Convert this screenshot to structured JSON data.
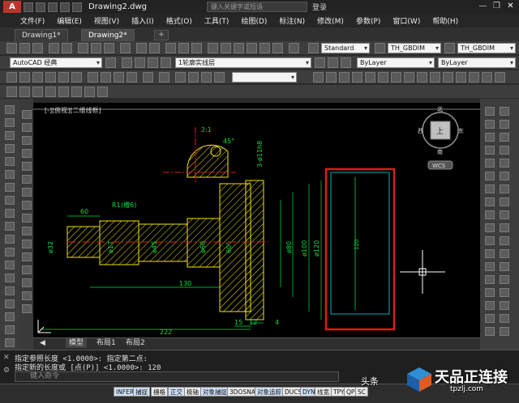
{
  "titlebar": {
    "logo": "A",
    "document_title": "Drawing2.dwg",
    "search_placeholder": "键入关键字或短语",
    "login": "登录",
    "minimize": "—",
    "restore": "❐",
    "close": "✕"
  },
  "menu": [
    "文件(F)",
    "编辑(E)",
    "视图(V)",
    "插入(I)",
    "格式(O)",
    "工具(T)",
    "绘图(D)",
    "标注(N)",
    "修改(M)",
    "参数(P)",
    "窗口(W)",
    "帮助(H)"
  ],
  "tabs": [
    {
      "label": "Drawing1*"
    },
    {
      "label": "Drawing2*"
    }
  ],
  "toolbar": {
    "dimstyle": "TH_GBDIM",
    "dimstyle2": "TH_GBDIM",
    "workspace": "AutoCAD 经典",
    "layer": "1轮廓实线层",
    "color": "ByLayer",
    "linetype": "ByLayer"
  },
  "canvas": {
    "viewport_label": "[-][俯视][二维线框]",
    "viewcube": {
      "north": "北",
      "south": "南",
      "west": "西",
      "east": "东",
      "top": "上",
      "wcs": "WCS"
    },
    "dims": {
      "d1": "2:1",
      "d2": "45°",
      "d3": "3-ø11h8",
      "d4": "R1",
      "d5": "(槽6)",
      "d6": "60",
      "d7": "ø32",
      "d8": "ø17",
      "d9": "ø45",
      "d10": "ø60",
      "d11": "60°",
      "d12": "ø80",
      "d13": "ø100",
      "d14": "ø120",
      "d15": "120",
      "d16": "130",
      "d17": "15",
      "d18": "12",
      "d19": "4",
      "d20": "222"
    }
  },
  "layout_tabs": [
    "模型",
    "布局1",
    "布局2"
  ],
  "command": {
    "line1": "指定参照长度 <1.0000>:  指定第二点:",
    "line2": "指定新的长度或 [点(P)] <1.0000>: 120",
    "prompt": "键入命令"
  },
  "statusbar": [
    "INFER",
    "捕捉",
    "栅格",
    "正交",
    "极轴",
    "对象捕捉",
    "3DOSNAP",
    "对象追踪",
    "DUCS",
    "DYN",
    "线宽",
    "TPY",
    "QP",
    "SC"
  ],
  "watermark": {
    "brand": "天品正连接",
    "url": "tpzlj.com",
    "small": "头条"
  },
  "colors": {
    "red_box": "#e01b1b",
    "dim_green": "#00e040",
    "yellow": "#f2e600",
    "cyan": "#00d8e8",
    "white": "#ffffff",
    "center_red": "#e01b1b"
  }
}
